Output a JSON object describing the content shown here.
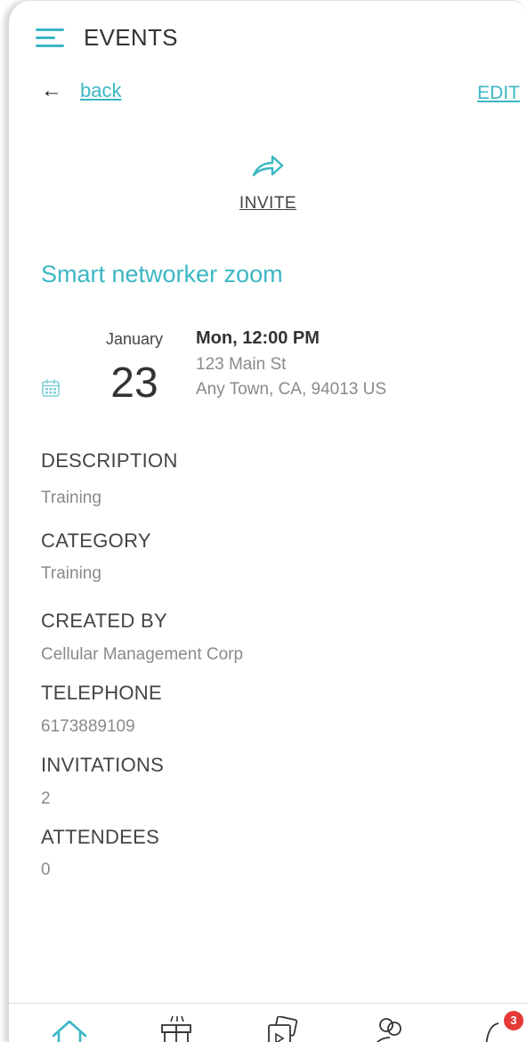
{
  "header": {
    "title": "EVENTS"
  },
  "nav": {
    "back_label": "back",
    "edit_label": "EDIT"
  },
  "invite": {
    "label": "INVITE"
  },
  "event": {
    "title": "Smart networker zoom",
    "month": "January",
    "day": "23",
    "time": "Mon, 12:00 PM",
    "address_line1": "123 Main St",
    "address_line2": "Any Town,  CA, 94013 US"
  },
  "fields": {
    "description": {
      "label": "DESCRIPTION",
      "value": "Training"
    },
    "category": {
      "label": "CATEGORY",
      "value": "Training"
    },
    "created_by": {
      "label": "CREATED BY",
      "value": "Cellular Management Corp"
    },
    "telephone": {
      "label": "TELEPHONE",
      "value": "6173889109"
    },
    "invitations": {
      "label": "INVITATIONS",
      "value": "2"
    },
    "attendees": {
      "label": "ATTENDEES",
      "value": "0"
    }
  },
  "bottom_nav": {
    "items": [
      {
        "icon": "home-icon"
      },
      {
        "icon": "gift-icon"
      },
      {
        "icon": "media-icon"
      },
      {
        "icon": "people-icon"
      },
      {
        "icon": "bell-icon",
        "badge": "3"
      }
    ]
  },
  "colors": {
    "accent": "#3bb7c4",
    "badge": "#e53935"
  }
}
